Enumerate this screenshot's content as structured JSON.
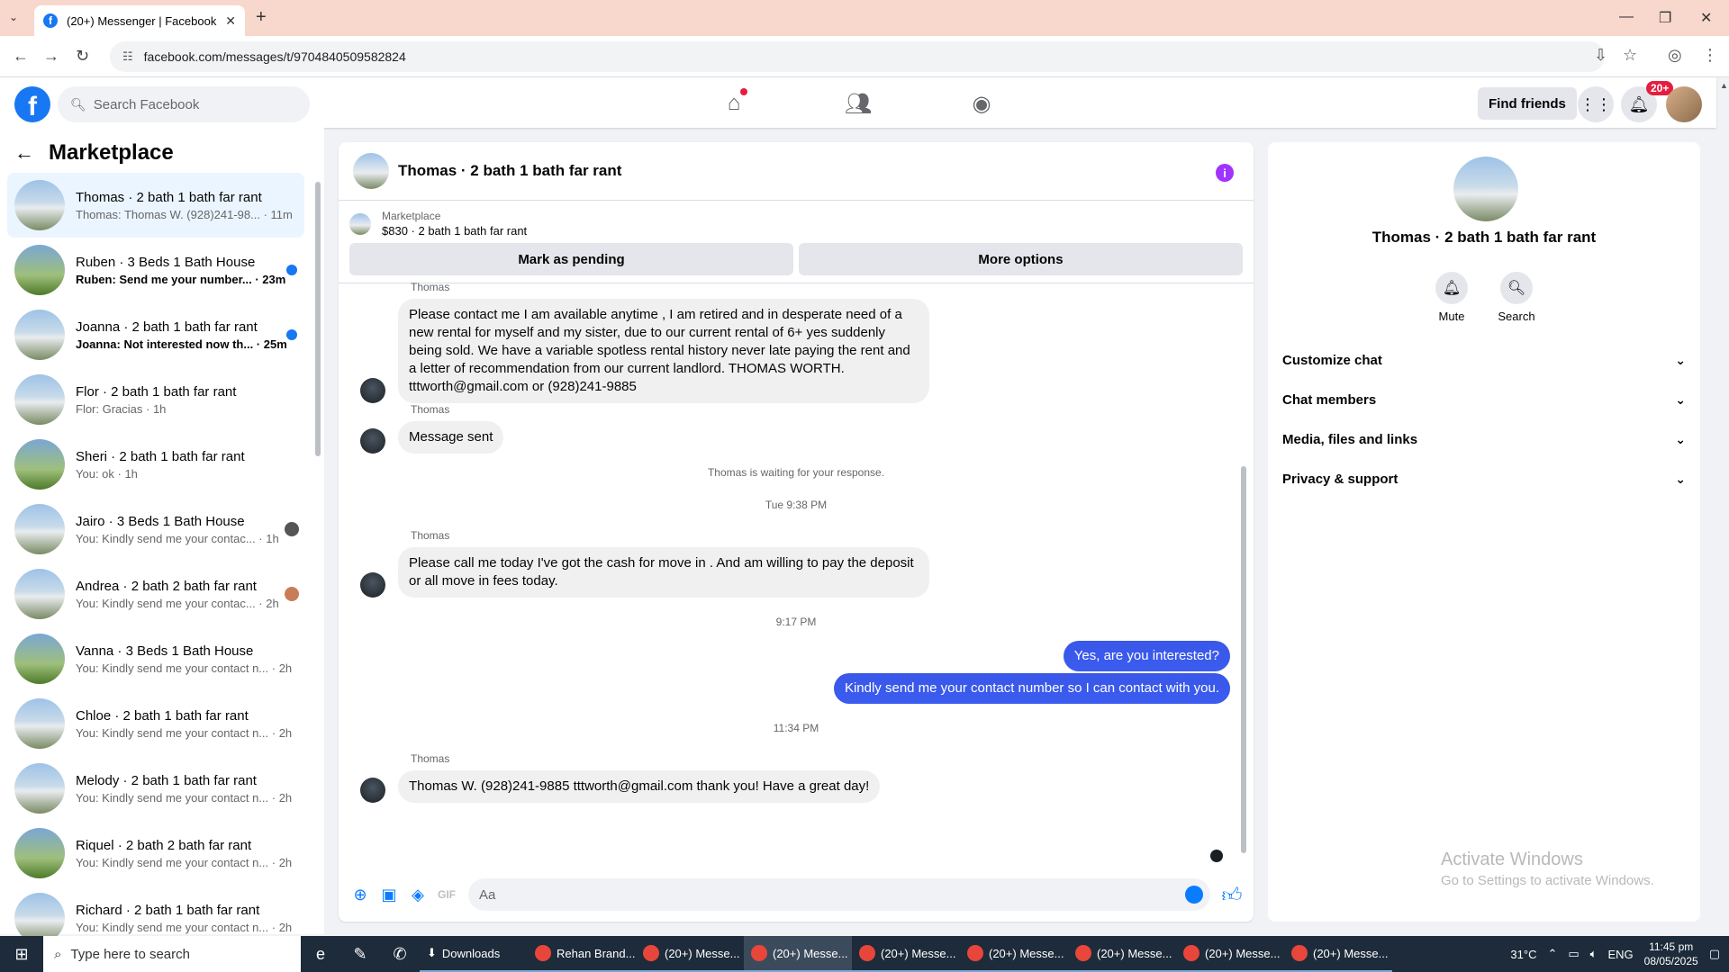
{
  "browser": {
    "tab_title": "(20+) Messenger | Facebook",
    "url": "facebook.com/messages/t/9704840509582824"
  },
  "fb": {
    "search_placeholder": "Search Facebook",
    "find_friends": "Find friends",
    "notif_badge": "20+"
  },
  "sidebar": {
    "title": "Marketplace",
    "conversations": [
      {
        "name": "Thomas · 2 bath 1 bath far rant",
        "snippet": "Thomas: Thomas W. (928)241-98... · 11m",
        "active": true,
        "unread": false
      },
      {
        "name": "Ruben · 3 Beds 1 Bath House",
        "snippet": "Ruben: Send me your number... · 23m",
        "unread": true
      },
      {
        "name": "Joanna · 2 bath 1 bath far rant",
        "snippet": "Joanna: Not interested now th... · 25m",
        "unread": true
      },
      {
        "name": "Flor · 2 bath 1 bath far rant",
        "snippet": "Flor: Gracias · 1h",
        "unread": false
      },
      {
        "name": "Sheri · 2 bath 1 bath far rant",
        "snippet": "You: ok · 1h",
        "unread": false
      },
      {
        "name": "Jairo · 3 Beds 1 Bath House",
        "snippet": "You: Kindly send me your contac... · 1h",
        "unread": false
      },
      {
        "name": "Andrea · 2 bath 2 bath far rant",
        "snippet": "You: Kindly send me your contac... · 2h",
        "unread": false
      },
      {
        "name": "Vanna · 3 Beds 1 Bath House",
        "snippet": "You: Kindly send me your contact n... · 2h",
        "unread": false
      },
      {
        "name": "Chloe · 2 bath 1 bath far rant",
        "snippet": "You: Kindly send me your contact n... · 2h",
        "unread": false
      },
      {
        "name": "Melody · 2 bath 1 bath far rant",
        "snippet": "You: Kindly send me your contact n... · 2h",
        "unread": false
      },
      {
        "name": "Riquel · 2 bath 2 bath far rant",
        "snippet": "You: Kindly send me your contact n... · 2h",
        "unread": false
      },
      {
        "name": "Richard · 2 bath 1 bath far rant",
        "snippet": "You: Kindly send me your contact n... · 2h",
        "unread": false
      }
    ]
  },
  "chat": {
    "title": "Thomas · 2 bath 1 bath far rant",
    "marketplace_label": "Marketplace",
    "listing": "$830 · 2 bath 1 bath far rant",
    "mark_pending": "Mark as pending",
    "more_options": "More options",
    "sender": "Thomas",
    "msg1": "Please contact me I am available anytime , I am retired   and in desperate need of a new rental for myself and my sister, due to our current rental of 6+ yes suddenly being sold. We have a variable spotless rental history never late paying the rent and a letter of recommendation from our current landlord. THOMAS WORTH. tttworth@gmail.com or (928)241-9885",
    "msg2": "Message sent",
    "waiting": "Thomas is waiting for your response.",
    "ts1": "Tue 9:38 PM",
    "msg3": "Please call me today I've got the cash for move in . And am willing to pay the deposit or all move in fees today.",
    "ts2": "9:17 PM",
    "out1": "Yes, are you interested?",
    "out2": "Kindly send me your contact number so I can contact with you.",
    "ts3": "11:34 PM",
    "msg4": "Thomas W.  (928)241-9885 tttworth@gmail.com  thank you!  Have a great day!",
    "composer_placeholder": "Aa"
  },
  "info": {
    "name": "Thomas · 2 bath 1 bath far rant",
    "mute": "Mute",
    "search": "Search",
    "sections": [
      "Customize chat",
      "Chat members",
      "Media, files and links",
      "Privacy & support"
    ]
  },
  "watermark": {
    "line1": "Activate Windows",
    "line2": "Go to Settings to activate Windows."
  },
  "taskbar": {
    "search_placeholder": "Type here to search",
    "apps": [
      "Downloads",
      "Rehan Brand...",
      "(20+) Messe...",
      "(20+) Messe...",
      "(20+) Messe...",
      "(20+) Messe...",
      "(20+) Messe...",
      "(20+) Messe...",
      "(20+) Messe..."
    ],
    "temp": "31°C",
    "lang": "ENG",
    "time": "11:45 pm",
    "date": "08/05/2025"
  }
}
